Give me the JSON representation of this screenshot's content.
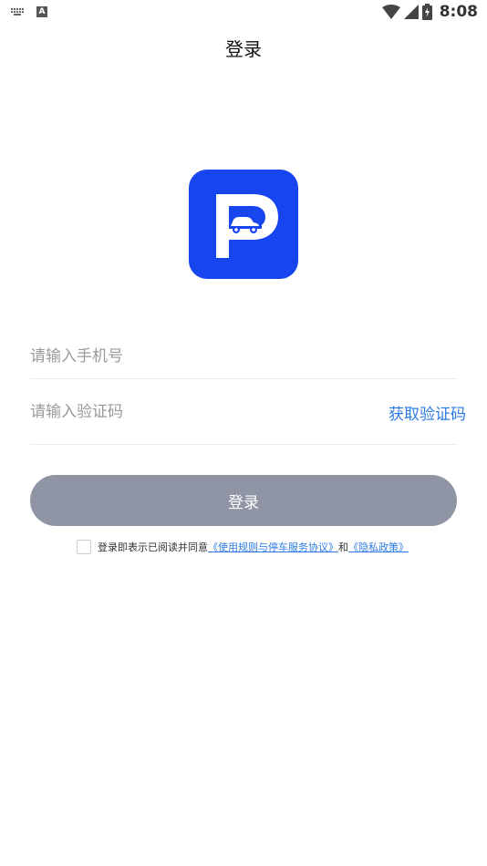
{
  "status_bar": {
    "time": "8:08",
    "left_icons": [
      "keyboard-icon",
      "a-notification-icon"
    ],
    "right_icons": [
      "wifi-icon",
      "signal-icon",
      "battery-icon"
    ]
  },
  "header": {
    "title": "登录"
  },
  "logo": {
    "icon": "parking-car-logo-icon",
    "color": "#1746f0"
  },
  "form": {
    "phone_placeholder": "请输入手机号",
    "phone_value": "",
    "code_placeholder": "请输入验证码",
    "code_value": "",
    "get_code_label": "获取验证码"
  },
  "login_button": {
    "label": "登录",
    "color": "#8f95a4"
  },
  "agreement": {
    "checked": false,
    "prefix": "登录即表示已阅读并同意",
    "user_agreement": "《使用规则与停车服务协议》",
    "conjunction": "和",
    "privacy_policy": "《隐私政策》",
    "link_color": "#2c7be5"
  }
}
